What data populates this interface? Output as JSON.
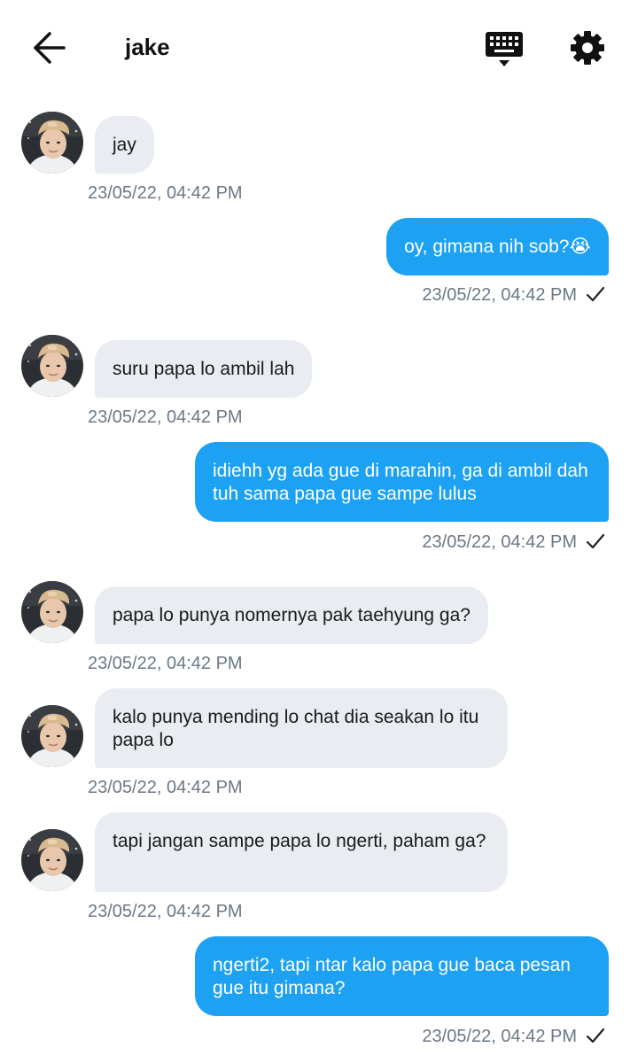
{
  "header": {
    "title": "jake",
    "back_icon": "arrow-left-icon",
    "keyboard_icon": "keyboard-icon",
    "settings_icon": "gear-icon"
  },
  "colors": {
    "incoming_bubble": "#e9edf1",
    "outgoing_bubble": "#1da1f2",
    "timestamp": "#6b7886"
  },
  "messages": [
    {
      "direction": "in",
      "text": "jay",
      "time": "23/05/22, 04:42 PM"
    },
    {
      "direction": "out",
      "text": "oy, gimana nih sob?😭",
      "time": "23/05/22, 04:42 PM",
      "status": "sent-check-icon"
    },
    {
      "direction": "in",
      "text": "suru papa lo ambil lah",
      "time": "23/05/22, 04:42 PM"
    },
    {
      "direction": "out",
      "text": "idiehh yg ada gue di marahin, ga di ambil dah tuh sama papa gue sampe lulus",
      "time": "23/05/22, 04:42 PM",
      "status": "sent-check-icon"
    },
    {
      "direction": "in",
      "text": "papa lo punya nomernya pak taehyung ga?",
      "time": "23/05/22, 04:42 PM"
    },
    {
      "direction": "in",
      "text": "kalo punya mending lo chat dia seakan lo itu papa lo",
      "time": "23/05/22, 04:42 PM"
    },
    {
      "direction": "in",
      "text": "tapi jangan sampe papa lo ngerti, paham ga?",
      "time": "23/05/22, 04:42 PM"
    },
    {
      "direction": "out",
      "text": "ngerti2, tapi ntar kalo papa gue baca pesan gue itu gimana?",
      "time": "23/05/22, 04:42 PM",
      "status": "sent-check-icon"
    }
  ]
}
